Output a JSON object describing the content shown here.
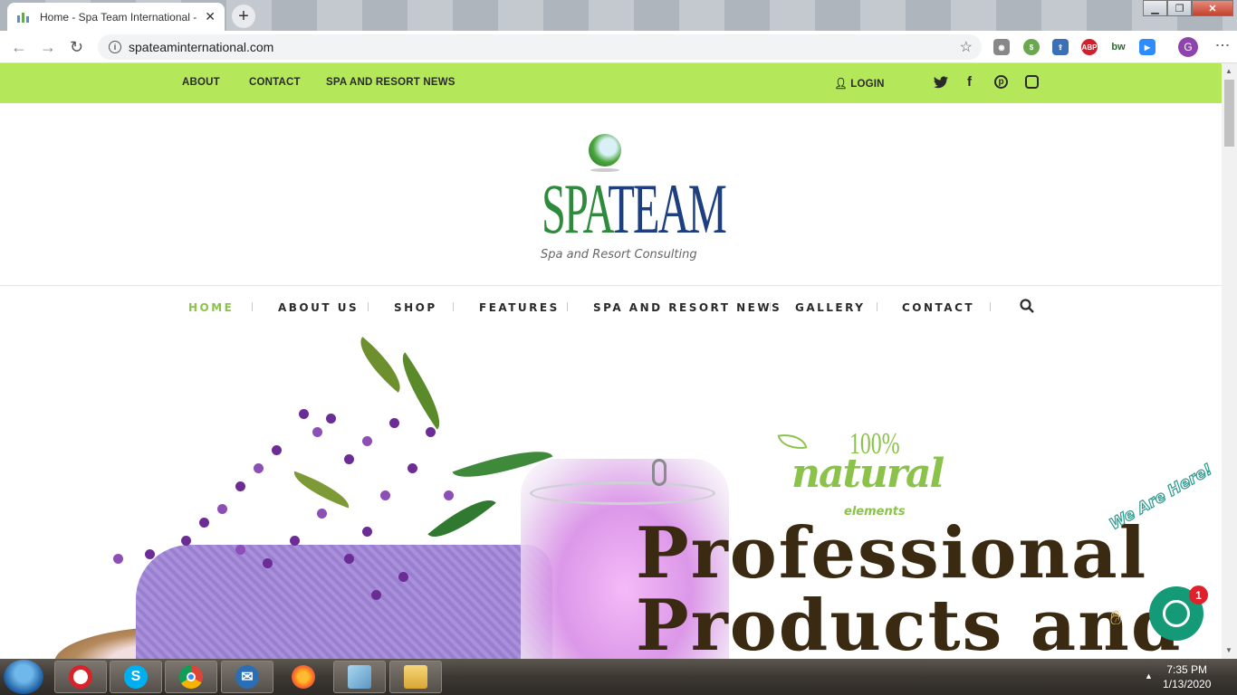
{
  "browser": {
    "tab_title": "Home - Spa Team International -",
    "tab_close": "✕",
    "new_tab": "+",
    "url": "spateaminternational.com",
    "profile_initial": "G",
    "extensions": [
      "camera",
      "coupon",
      "upload",
      "ABP",
      "bw",
      "zoom"
    ],
    "ext_abp": "ABP",
    "ext_bw": "bw"
  },
  "topbar": {
    "links": [
      "ABOUT",
      "CONTACT",
      "SPA AND RESORT NEWS"
    ],
    "login": "LOGIN",
    "social_icons": [
      "twitter-icon",
      "facebook-icon",
      "pinterest-icon",
      "instagram-icon"
    ],
    "background_color": "#b5e75b"
  },
  "logo": {
    "spa": "SPA",
    "team": "TEAM",
    "tagline": "Spa and Resort Consulting"
  },
  "nav": {
    "items": [
      "HOME",
      "ABOUT US",
      "SHOP",
      "FEATURES",
      "SPA AND RESORT NEWS",
      "GALLERY",
      "CONTACT"
    ],
    "active": "HOME",
    "active_color": "#8bc34a"
  },
  "hero": {
    "badge_percent": "100%",
    "badge_word": "natural",
    "badge_sub": "elements",
    "headline_line1": "Professional",
    "headline_line2": "Products and"
  },
  "chat": {
    "callout": "We Are Here!",
    "badge_count": "1"
  },
  "taskbar": {
    "apps": [
      "opera",
      "skype",
      "chrome",
      "thunderbird",
      "firefox",
      "notepad",
      "file-explorer"
    ],
    "time": "7:35 PM",
    "date": "1/13/2020"
  }
}
